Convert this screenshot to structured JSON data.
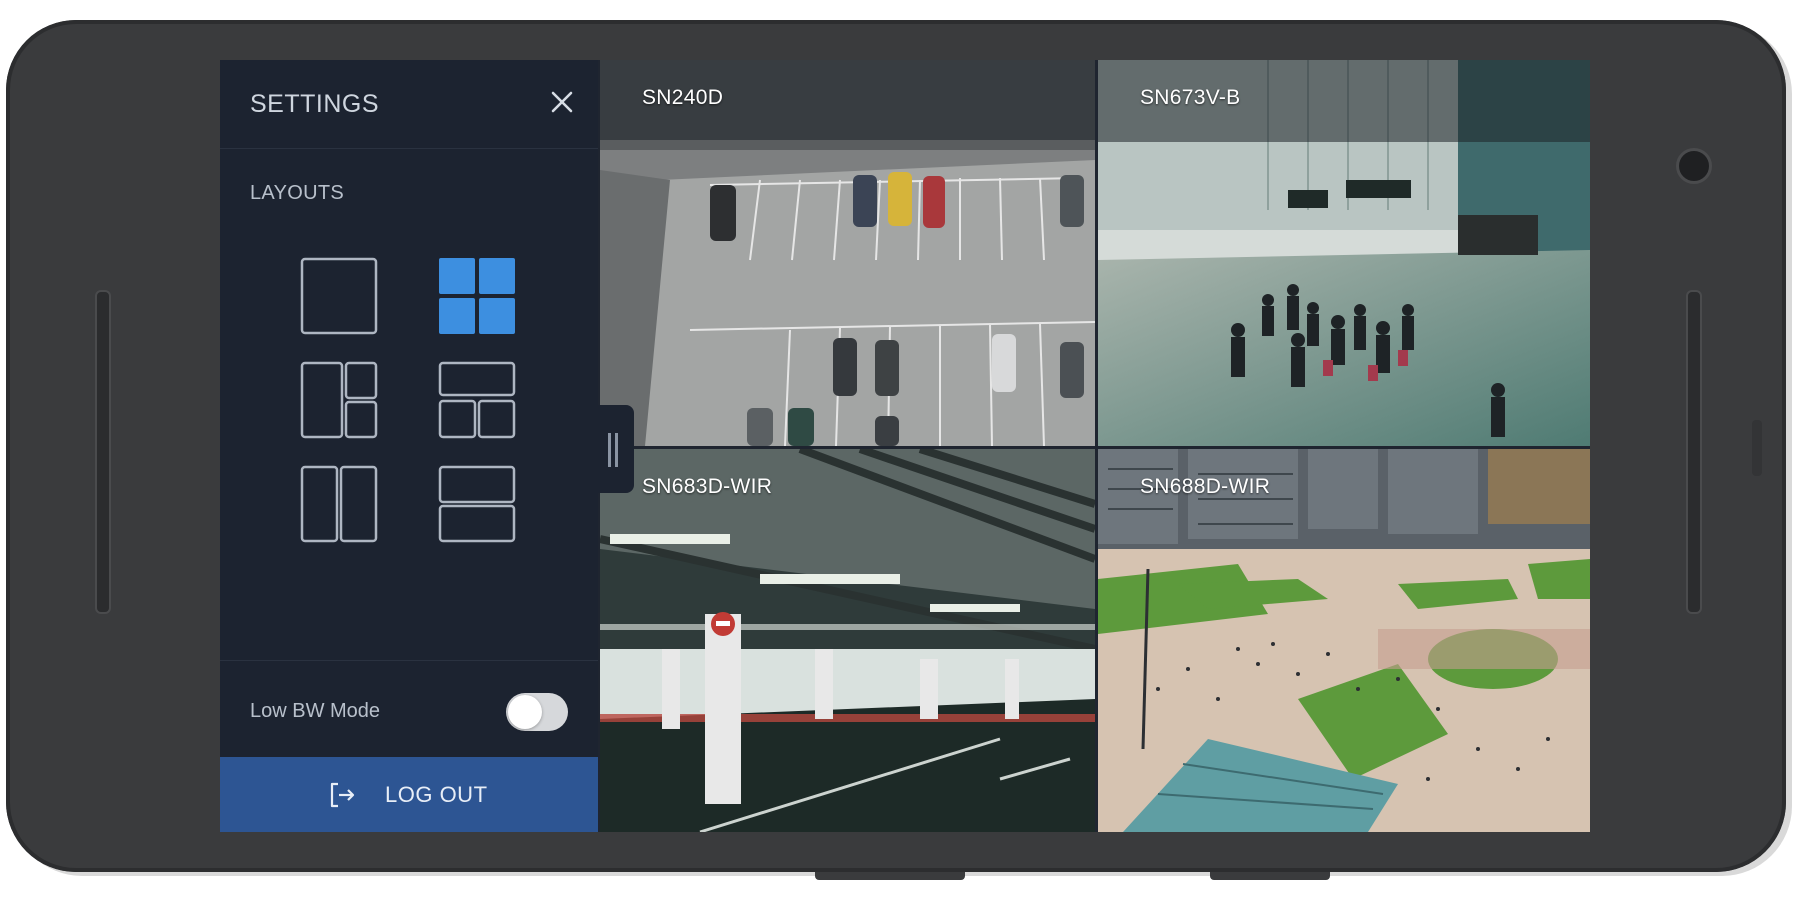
{
  "settings": {
    "title": "SETTINGS",
    "layouts_title": "LAYOUTS",
    "layout_options": [
      {
        "name": "single",
        "selected": false
      },
      {
        "name": "quad-2x2",
        "selected": true
      },
      {
        "name": "one-large-two-small",
        "selected": false
      },
      {
        "name": "one-top-two-bottom",
        "selected": false
      },
      {
        "name": "two-columns",
        "selected": false
      },
      {
        "name": "two-rows",
        "selected": false
      }
    ],
    "low_bw_label": "Low BW Mode",
    "low_bw_enabled": false,
    "logout_label": "LOG OUT"
  },
  "cameras": [
    {
      "label": "SN240D",
      "scene": "rooftop parking lot"
    },
    {
      "label": "SN673V-B",
      "scene": "airport terminal"
    },
    {
      "label": "SN683D-WIR",
      "scene": "underground parking garage"
    },
    {
      "label": "SN688D-WIR",
      "scene": "city plaza"
    }
  ],
  "colors": {
    "panel_bg": "#1c2330",
    "accent_blue": "#3d8fe0",
    "logout_bg": "#2d5593",
    "phone_body": "#3a3b3d"
  }
}
